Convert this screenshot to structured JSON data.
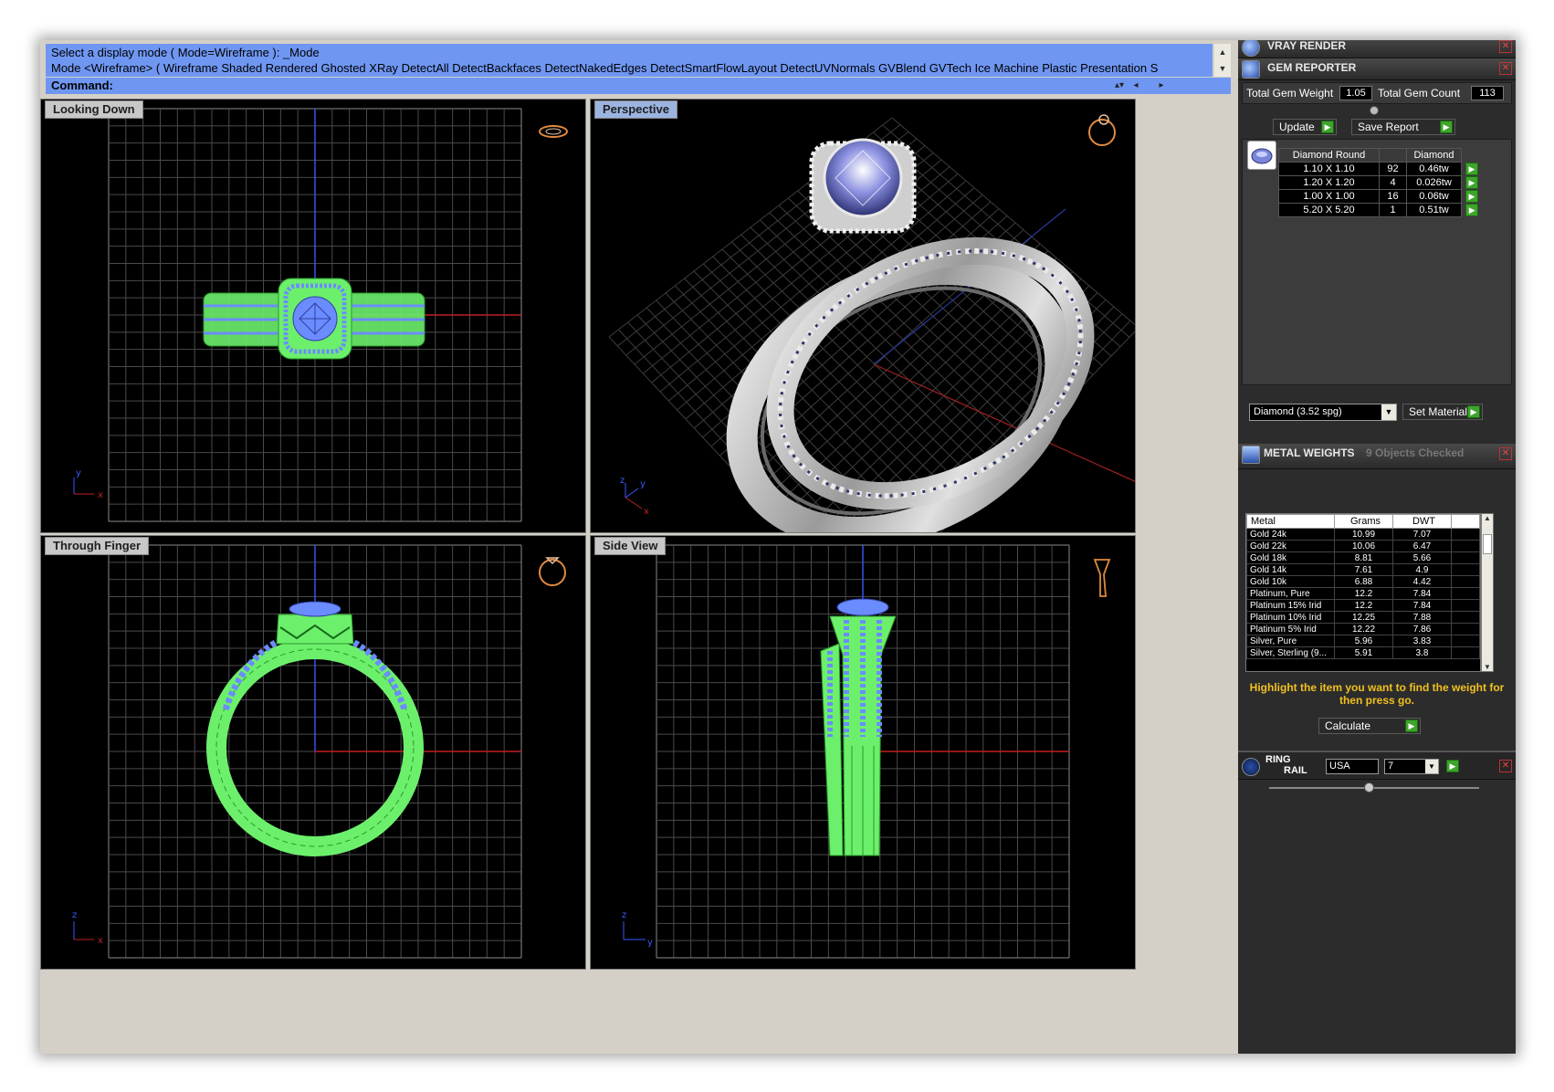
{
  "command": {
    "history_line1": "Select a display mode ( Mode=Wireframe ): _Mode",
    "history_line2": "Mode <Wireframe> ( Wireframe  Shaded  Rendered  Ghosted  XRay  DetectAll  DetectBackfaces  DetectNakedEdges  DetectSmartFlowLayout  DetectUVNormals  GVBlend  GVTech  Ice  Machine  Plastic  Presentation  S",
    "prompt_label": "Command:",
    "input_value": ""
  },
  "viewports": [
    {
      "title": "Looking Down"
    },
    {
      "title": "Perspective"
    },
    {
      "title": "Through Finger"
    },
    {
      "title": "Side View"
    }
  ],
  "axes": {
    "x": "x",
    "y": "y",
    "z": "z"
  },
  "panel": {
    "vray": {
      "title": "VRAY RENDER"
    },
    "gem": {
      "title": "GEM REPORTER",
      "total_weight_label": "Total Gem Weight",
      "total_weight": "1.05",
      "total_count_label": "Total Gem Count",
      "total_count": "113",
      "update_label": "Update",
      "save_label": "Save Report",
      "table_headers": [
        "Diamond Round",
        "",
        "Diamond"
      ],
      "rows": [
        {
          "size": "1.10 X 1.10",
          "count": "92",
          "weight": "0.46tw"
        },
        {
          "size": "1.20 X 1.20",
          "count": "4",
          "weight": "0.026tw"
        },
        {
          "size": "1.00 X 1.00",
          "count": "16",
          "weight": "0.06tw"
        },
        {
          "size": "5.20 X 5.20",
          "count": "1",
          "weight": "0.51tw"
        }
      ],
      "material_select": "Diamond     (3.52 spg)",
      "set_material_label": "Set Material"
    },
    "metal": {
      "title": "METAL WEIGHTS",
      "status": "9 Objects Checked",
      "headers": [
        "Metal",
        "Grams",
        "DWT"
      ],
      "rows": [
        {
          "name": "Gold 24k",
          "grams": "10.99",
          "dwt": "7.07"
        },
        {
          "name": "Gold 22k",
          "grams": "10.06",
          "dwt": "6.47"
        },
        {
          "name": "Gold 18k",
          "grams": "8.81",
          "dwt": "5.66"
        },
        {
          "name": "Gold 14k",
          "grams": "7.61",
          "dwt": "4.9"
        },
        {
          "name": "Gold 10k",
          "grams": "6.88",
          "dwt": "4.42"
        },
        {
          "name": "Platinum, Pure",
          "grams": "12.2",
          "dwt": "7.84"
        },
        {
          "name": "Platinum 15% Irid",
          "grams": "12.2",
          "dwt": "7.84"
        },
        {
          "name": "Platinum 10% Irid",
          "grams": "12.25",
          "dwt": "7.88"
        },
        {
          "name": "Platinum 5% Irid",
          "grams": "12.22",
          "dwt": "7.86"
        },
        {
          "name": "Silver, Pure",
          "grams": "5.96",
          "dwt": "3.83"
        },
        {
          "name": "Silver, Sterling (9...",
          "grams": "5.91",
          "dwt": "3.8"
        }
      ],
      "hint": "Highlight the item you want to find the weight for then press go.",
      "calculate_label": "Calculate"
    },
    "ringrail": {
      "title_line1": "RING",
      "title_line2": "RAIL",
      "region": "USA",
      "size": "7"
    }
  },
  "colors": {
    "command_bg": "#6f97f2",
    "wire_green": "#6cf06c",
    "gem_blue": "#6b8cff",
    "go_green": "#3da52b",
    "hint_yellow": "#f0c020"
  }
}
